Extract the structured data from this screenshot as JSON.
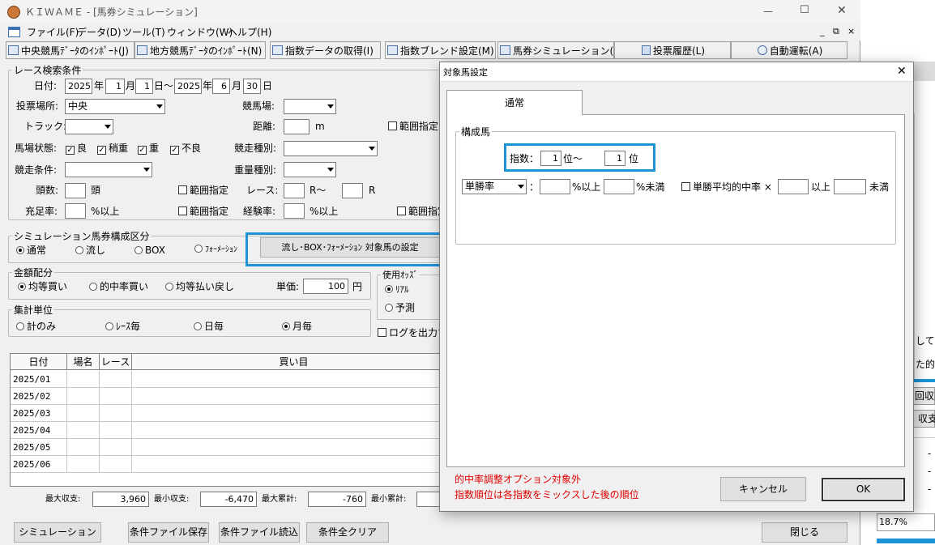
{
  "app": {
    "title": "ＫＩＷＡＭＥ - [馬券シミュレーション]",
    "window_controls": [
      "—",
      "☐",
      "✕"
    ],
    "mdi_controls": [
      "_",
      "⧉",
      "×"
    ]
  },
  "menu": [
    "ファイル(F)",
    "データ(D)",
    "ツール(T)",
    "ウィンドウ(W)",
    "ヘルプ(H)"
  ],
  "toolbar": [
    "中央競馬ﾃﾞｰﾀのｲﾝﾎﾟｰﾄ(J)",
    "地方競馬ﾃﾞｰﾀのｲﾝﾎﾟｰﾄ(N)",
    "指数データの取得(I)",
    "指数ブレンド設定(M)",
    "馬券シミュレーション(B)",
    "投票履歴(L)",
    "自動運転(A)"
  ],
  "search": {
    "group_title": "レース検索条件",
    "date_label": "日付:",
    "from_year": "2025",
    "year_unit": "年",
    "from_month": "1",
    "month_unit": "月",
    "from_day": "1",
    "day_unit_range": "日～",
    "to_year": "2025",
    "to_month": "6",
    "to_day": "30",
    "day_unit": "日",
    "venue_type_label": "投票場所:",
    "venue_type_value": "中央",
    "course_label": "競馬場:",
    "course_value": "",
    "track_label": "トラック:",
    "track_value": "",
    "distance_label": "距離:",
    "distance_value": "",
    "distance_unit": "m",
    "range_label": "範囲指定",
    "ground_label": "馬場状態:",
    "ground_options": [
      "良",
      "稍重",
      "重",
      "不良"
    ],
    "race_type_label": "競走種別:",
    "race_type_value": "",
    "race_cond_label": "競走条件:",
    "race_cond_value": "",
    "weight_type_label": "重量種別:",
    "weight_type_value": "",
    "heads_label": "頭数:",
    "heads_value": "",
    "heads_unit": "頭",
    "race_label": "レース:",
    "race_from": "",
    "race_mid": "R～",
    "race_to": "",
    "race_unit": "R",
    "fill_label": "充足率:",
    "fill_value": "",
    "fill_unit": "%以上",
    "exp_label": "経験率:",
    "exp_value": "",
    "exp_unit": "%以上"
  },
  "bettype": {
    "group_title": "シミュレーション馬券構成区分",
    "options": [
      "通常",
      "流し",
      "BOX",
      "ﾌｫｰﾒｰｼｮﾝ"
    ],
    "selected": "通常",
    "setting_button": "流し･BOX･ﾌｫｰﾒｰｼｮﾝ 対象馬の設定"
  },
  "money": {
    "group_title": "金額配分",
    "options": [
      "均等買い",
      "的中率買い",
      "均等払い戻し"
    ],
    "selected": "均等買い",
    "unit_label": "単価:",
    "unit_value": "100",
    "unit_suffix": "円"
  },
  "odds": {
    "group_title": "使用ｵｯｽﾞ",
    "options": [
      "ﾘｱﾙ",
      "予測"
    ],
    "selected": "ﾘｱﾙ"
  },
  "aggregate": {
    "group_title": "集計単位",
    "options": [
      "計のみ",
      "ﾚｰｽ毎",
      "日毎",
      "月毎"
    ],
    "selected": "月毎",
    "log_label": "ログを出力す"
  },
  "table": {
    "headers": [
      "日付",
      "場名",
      "レース",
      "買い目"
    ],
    "rows": [
      "2025/01",
      "2025/02",
      "2025/03",
      "2025/04",
      "2025/05",
      "2025/06"
    ]
  },
  "summary": {
    "max_income_label": "最大収支:",
    "max_income": "3,960",
    "min_income_label": "最小収支:",
    "min_income": "-6,470",
    "max_cum_label": "最大累計:",
    "max_cum": "-760",
    "min_cum_label": "最小累計:",
    "min_cum": ""
  },
  "bottom_buttons": {
    "simulate": "シミュレーション",
    "save": "条件ファイル保存",
    "load": "条件ファイル読込",
    "clear": "条件全クリア",
    "close": "閉じる"
  },
  "dialog": {
    "title": "対象馬設定",
    "close_icon": "✕",
    "tab": "通常",
    "group_title": "構成馬",
    "index_label": "指数：",
    "index_from": "1",
    "index_from_unit": "位～",
    "index_to": "1",
    "index_to_unit": "位",
    "rate_select": "単勝率",
    "colon": "：",
    "rate_from": "",
    "rate_from_unit": "%以上",
    "rate_to": "",
    "rate_to_unit": "%未満",
    "avg_label": "単勝平均的中率 ×",
    "avg_from": "",
    "avg_from_unit": "以上",
    "avg_to": "",
    "avg_to_unit": "未満",
    "note1": "的中率調整オプション対象外",
    "note2": "指数順位は各指数をミックスした後の順位",
    "cancel": "キャンセル",
    "ok": "OK"
  },
  "right_panel": {
    "frag1": "して的",
    "frag2": "た的",
    "frag3": "回収率",
    "frag4": "収支",
    "frag5": "18.7%"
  },
  "colors": {
    "highlight": "#1d94d8",
    "note_red": "#e00000",
    "accent_bar": "#1d94d8"
  }
}
